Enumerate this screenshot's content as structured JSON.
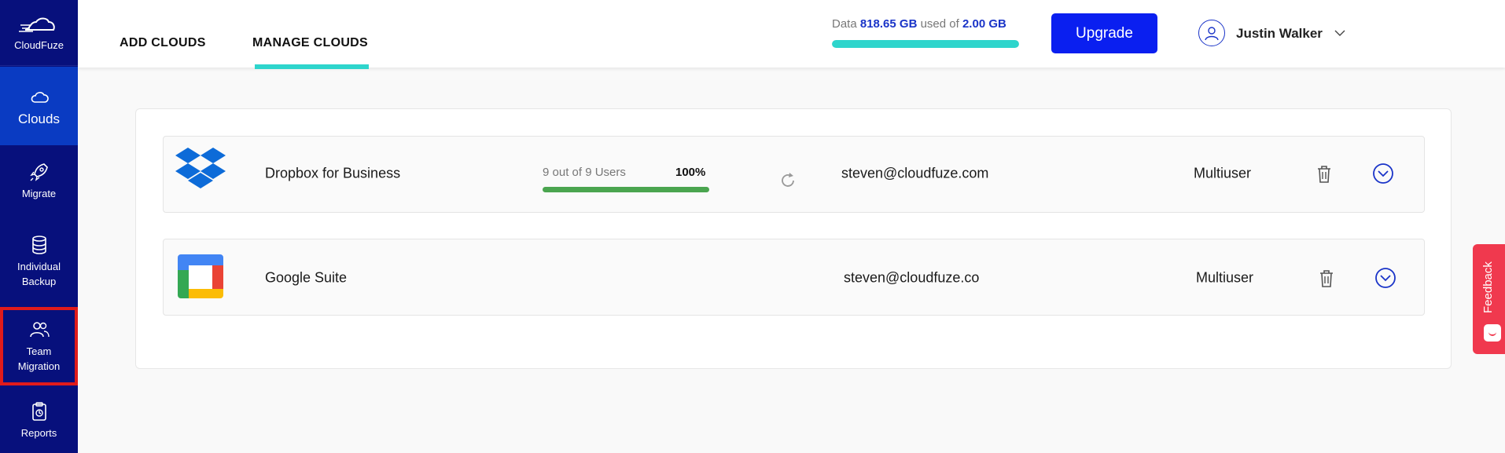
{
  "sidebar": {
    "logo_text": "CloudFuze",
    "items": [
      {
        "label": "Clouds"
      },
      {
        "label": "Migrate"
      },
      {
        "label": "Individual Backup"
      },
      {
        "label": "Team Migration"
      },
      {
        "label": "Reports"
      }
    ]
  },
  "header": {
    "tabs": [
      {
        "label": "ADD CLOUDS"
      },
      {
        "label": "MANAGE CLOUDS"
      }
    ],
    "storage": {
      "prefix": "Data",
      "used": "818.65 GB",
      "middle": "used of",
      "total": "2.00 GB",
      "fill_percent": 100
    },
    "upgrade_label": "Upgrade",
    "user_name": "Justin Walker"
  },
  "clouds": [
    {
      "name": "Dropbox for Business",
      "users_text": "9 out of 9 Users",
      "percent_text": "100%",
      "progress": 100,
      "email": "steven@cloudfuze.com",
      "type": "Multiuser"
    },
    {
      "name": "Google Suite",
      "email": "steven@cloudfuze.co",
      "type": "Multiuser"
    }
  ],
  "feedback_label": "Feedback",
  "colors": {
    "sidebar": "#07107c",
    "active": "#0a3bc2",
    "accent": "#2ed5cc",
    "button": "#0a1ff0",
    "progress": "#4aa54f",
    "feedback": "#f0394e"
  }
}
